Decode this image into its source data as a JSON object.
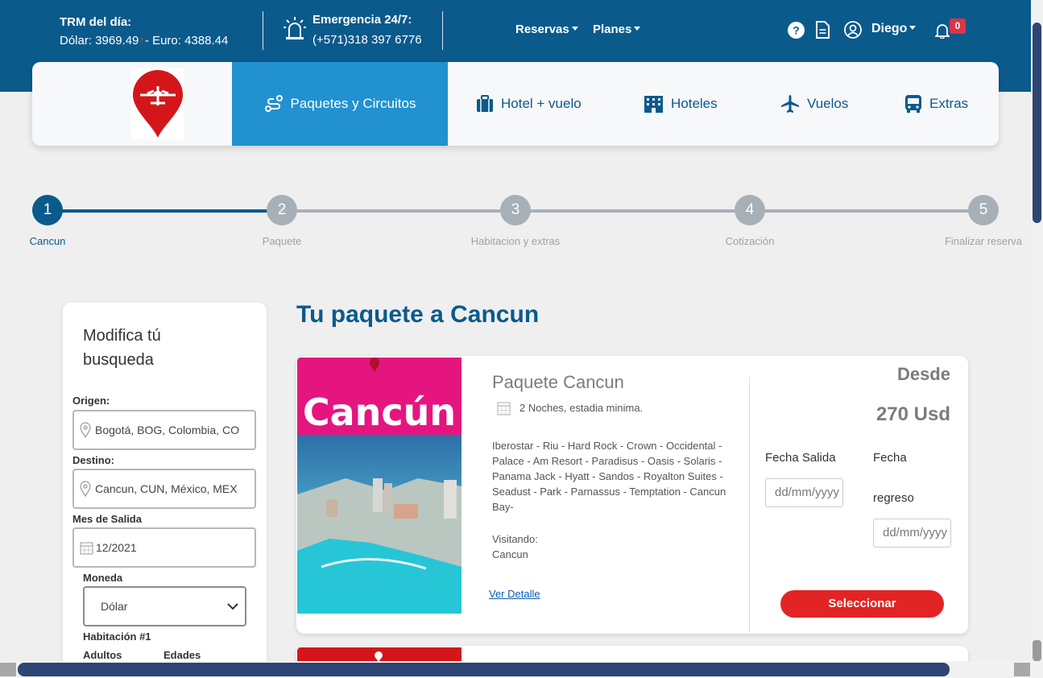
{
  "header": {
    "trm_title": "TRM del día:",
    "dolar_text": "Dólar: 3969.49",
    "arrow": "↑",
    "euro_text": "- Euro: 4388.44",
    "emergency_title": "Emergencia 24/7:",
    "emergency_phone": "(+571)318 397 6776",
    "reservas_label": "Reservas",
    "planes_label": "Planes",
    "user_name": "Diego",
    "notification_count": "0",
    "icons": [
      "alarm-light-icon",
      "help-icon",
      "document-icon",
      "user-circle-icon",
      "bell-icon"
    ]
  },
  "nav": {
    "tabs": [
      {
        "label": "Paquetes y Circuitos",
        "icon": "route-icon"
      },
      {
        "label": "Hotel + vuelo",
        "icon": "luggage-icon"
      },
      {
        "label": "Hoteles",
        "icon": "building-icon"
      },
      {
        "label": "Vuelos",
        "icon": "airplane-icon"
      },
      {
        "label": "Extras",
        "icon": "bus-icon"
      }
    ]
  },
  "steps": [
    {
      "num": "1",
      "label": "Cancun"
    },
    {
      "num": "2",
      "label": "Paquete"
    },
    {
      "num": "3",
      "label": "Habitacion y extras"
    },
    {
      "num": "4",
      "label": "Cotización"
    },
    {
      "num": "5",
      "label": "Finalizar reserva"
    }
  ],
  "sidebar": {
    "title": "Modifica tú busqueda",
    "origin_label": "Origen:",
    "origin_value": "Bogotá, BOG, Colombia, CO",
    "destination_label": "Destino:",
    "destination_value": "Cancun, CUN, México, MEX",
    "month_label": "Mes de Salida",
    "month_value": "12/2021",
    "currency_label": "Moneda",
    "currency_value": "Dólar",
    "room_label": "Habitación #1",
    "adults_label": "Adultos",
    "ages_label": "Edades"
  },
  "main": {
    "title": "Tu paquete a Cancun",
    "package": {
      "image_text": "Cancún",
      "name": "Paquete Cancun",
      "nights": "2 Noches, estadia minima.",
      "hotels": "Iberostar - Riu - Hard Rock - Crown - Occidental - Palace - Am Resort - Paradisus - Oasis - Solaris - Panama Jack - Hyatt - Sandos - Royalton Suites - Seadust - Park - Parnassus - Temptation - Cancun Bay-",
      "visit_label": "Visitando:",
      "visit_value": "Cancun",
      "detail_link": "Ver Detalle",
      "desde": "Desde",
      "price": "270 Usd",
      "departure_label": "Fecha Salida",
      "return_label_1": "Fecha",
      "return_label_2": "regreso",
      "date_placeholder": "dd/mm/yyyy",
      "select_button": "Seleccionar"
    }
  },
  "colors": {
    "brand_blue": "#0a5a8c",
    "active_tab": "#2191d0",
    "accent_red": "#e32424"
  }
}
